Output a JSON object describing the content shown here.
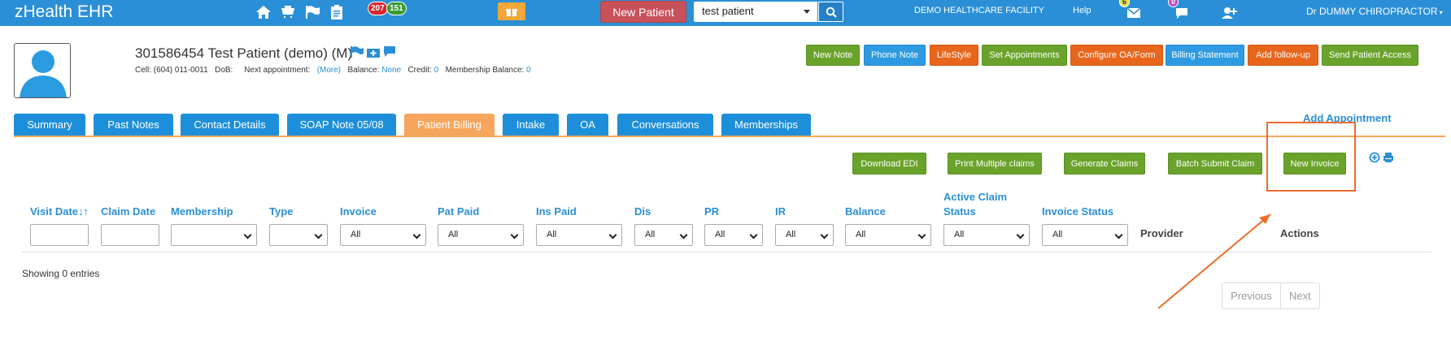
{
  "topbar": {
    "brand": "zHealth EHR",
    "badge_red": "207",
    "badge_green": "151",
    "new_patient_label": "New Patient",
    "search_value": "test patient",
    "facility": "DEMO HEALTHCARE FACILITY",
    "help": "Help",
    "mail_count": "6",
    "chat_count": "0",
    "doctor": "Dr DUMMY CHIROPRACTOR"
  },
  "patient": {
    "title": "301586454 Test Patient  (demo) (M)",
    "cell_label": "Cell: (604) 011-0011",
    "dob_label": "DoB:",
    "next_appt_label": "Next appointment:",
    "more_link": "(More)",
    "balance_label": "Balance:",
    "balance_value": "None",
    "credit_label": "Credit:",
    "credit_value": "0",
    "membership_label": "Membership Balance:",
    "membership_value": "0"
  },
  "header_buttons": [
    "New Note",
    "Phone Note",
    "LifeStyle",
    "Set Appointments",
    "Configure OA/Form",
    "Billing Statement",
    "Add follow-up",
    "Send Patient Access"
  ],
  "tabs": [
    "Summary",
    "Past Notes",
    "Contact Details",
    "SOAP Note 05/08",
    "Patient Billing",
    "Intake",
    "OA",
    "Conversations",
    "Memberships"
  ],
  "add_appointment": "Add Appointment",
  "action_buttons": [
    "Download EDI",
    "Print Multiple claims",
    "Generate Claims",
    "Batch Submit Claim",
    "New Invoice"
  ],
  "columns": {
    "visit_date": "Visit Date",
    "claim_date": "Claim Date",
    "membership": "Membership",
    "type": "Type",
    "invoice": "Invoice",
    "pat_paid": "Pat Paid",
    "ins_paid": "Ins Paid",
    "dis": "Dis",
    "pr": "PR",
    "ir": "IR",
    "balance": "Balance",
    "active_claim_1": "Active Claim",
    "active_claim_2": "Status",
    "invoice_status": "Invoice Status",
    "provider": "Provider",
    "actions": "Actions"
  },
  "filter_all": "All",
  "showing": "Showing 0 entries",
  "pager": {
    "previous": "Previous",
    "next": "Next"
  },
  "colors": {
    "topbar": "#2a8fd6",
    "green": "#6aa32b",
    "blue": "#2d9ae2",
    "orange": "#e8661c",
    "active_tab": "#f6a65c",
    "highlight": "#ef6b2a"
  },
  "icons": [
    "home-icon",
    "cart-icon",
    "flag-icon",
    "clipboard-icon",
    "gift-icon",
    "search-icon",
    "mail-icon",
    "chat-icon",
    "add-user-icon",
    "plus-circle-icon",
    "print-icon"
  ]
}
